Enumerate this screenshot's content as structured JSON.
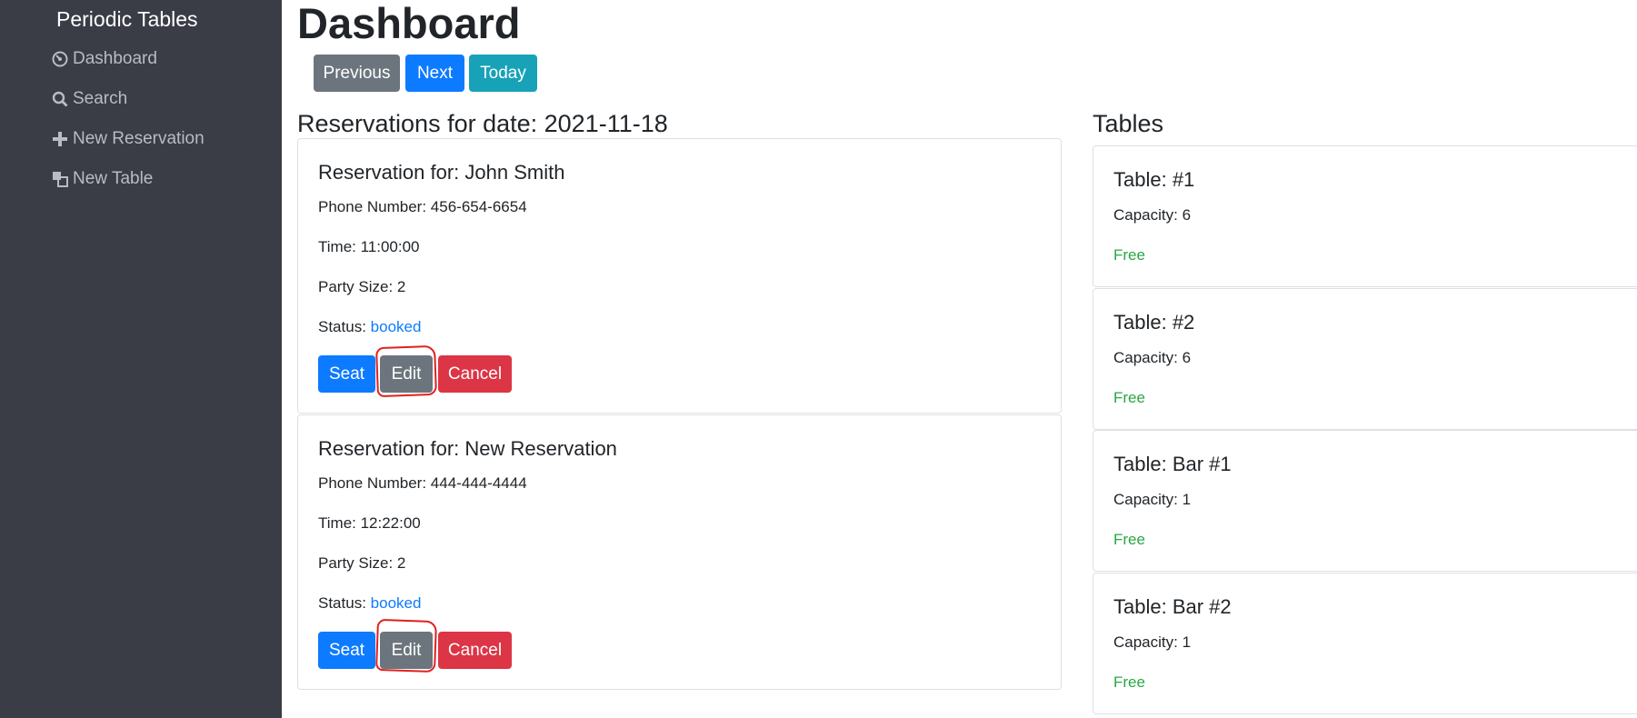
{
  "sidebar": {
    "brand": "Periodic Tables",
    "items": [
      {
        "label": "Dashboard",
        "icon": "dashboard-icon"
      },
      {
        "label": "Search",
        "icon": "search-icon"
      },
      {
        "label": "New Reservation",
        "icon": "plus-icon"
      },
      {
        "label": "New Table",
        "icon": "table-icon"
      }
    ]
  },
  "header": {
    "title": "Dashboard",
    "nav_buttons": {
      "previous": "Previous",
      "next": "Next",
      "today": "Today"
    }
  },
  "reservations": {
    "heading": "Reservations for date: 2021-11-18",
    "items": [
      {
        "title": "Reservation for: John Smith",
        "phone": "Phone Number: 456-654-6654",
        "time": "Time: 11:00:00",
        "party": "Party Size: 2",
        "status_label": "Status:",
        "status_value": "booked",
        "seat": "Seat",
        "edit": "Edit",
        "cancel": "Cancel"
      },
      {
        "title": "Reservation for: New Reservation",
        "phone": "Phone Number: 444-444-4444",
        "time": "Time: 12:22:00",
        "party": "Party Size: 2",
        "status_label": "Status:",
        "status_value": "booked",
        "seat": "Seat",
        "edit": "Edit",
        "cancel": "Cancel"
      }
    ]
  },
  "tables": {
    "heading": "Tables",
    "items": [
      {
        "title": "Table: #1",
        "capacity": "Capacity: 6",
        "status": "Free"
      },
      {
        "title": "Table: #2",
        "capacity": "Capacity: 6",
        "status": "Free"
      },
      {
        "title": "Table: Bar #1",
        "capacity": "Capacity: 1",
        "status": "Free"
      },
      {
        "title": "Table: Bar #2",
        "capacity": "Capacity: 1",
        "status": "Free"
      }
    ]
  },
  "colors": {
    "sidebar_bg": "#3a3c46",
    "primary": "#0d7bff",
    "secondary": "#6c757d",
    "info": "#17a2b8",
    "danger": "#dc3545",
    "success": "#28a745",
    "annotation": "#e02020"
  }
}
